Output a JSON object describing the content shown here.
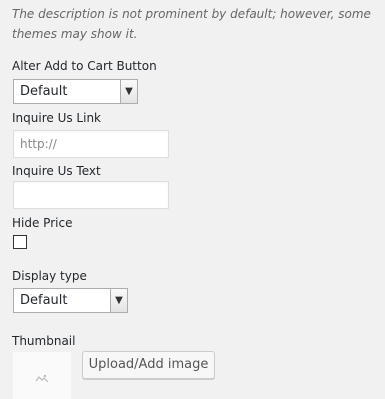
{
  "description": "The description is not prominent by default; however, some themes may show it.",
  "fields": {
    "alter_add_to_cart": {
      "label": "Alter Add to Cart Button",
      "value": "Default"
    },
    "inquire_link": {
      "label": "Inquire Us Link",
      "placeholder": "http://"
    },
    "inquire_text": {
      "label": "Inquire Us Text",
      "value": ""
    },
    "hide_price": {
      "label": "Hide Price",
      "checked": false
    },
    "display_type": {
      "label": "Display type",
      "value": "Default"
    },
    "thumbnail": {
      "label": "Thumbnail",
      "button": "Upload/Add image"
    }
  },
  "icons": {
    "dropdown": "chevron-down-icon",
    "thumbnail_placeholder": "image-placeholder-icon"
  }
}
